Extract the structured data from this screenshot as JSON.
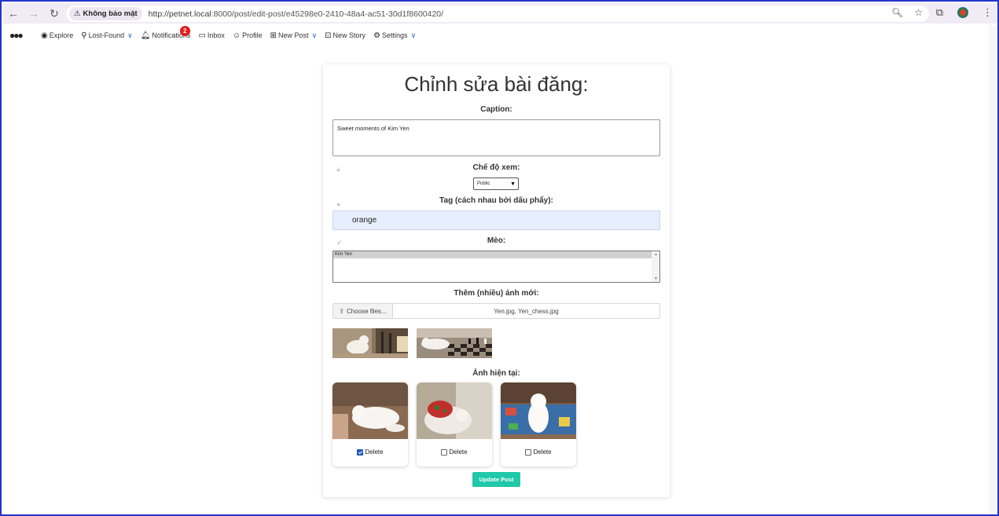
{
  "browser": {
    "security_label": "Không bảo mật",
    "url_host": "http://petnet.local",
    "url_rest": ":8000/post/edit-post/e45298e0-2410-48a4-ac51-30d1f8600420/"
  },
  "nav": {
    "explore": "Explore",
    "lost_found": "Lost-Found",
    "notifications": "Notifications",
    "notifications_count": "2",
    "inbox": "Inbox",
    "profile": "Profile",
    "new_post": "New Post",
    "new_story": "New Story",
    "settings": "Settings"
  },
  "form": {
    "title": "Chỉnh sửa bài đăng:",
    "caption_label": "Caption:",
    "caption_value": "Sweet moments of Kim Yen",
    "visibility_label": "Chế độ xem:",
    "visibility_value": "Public",
    "tag_label": "Tag (cách nhau bởi dấu phẩy):",
    "tag_value": "orange",
    "cat_label": "Mèo:",
    "cat_options": [
      "Kim Yen"
    ],
    "new_images_label": "Thêm (nhiều) ảnh mới:",
    "choose_files": "Choose files...",
    "chosen_files": "Yen.jpg, Yen_chess.jpg",
    "current_images_label": "Ảnh hiện tại:",
    "delete_label": "Delete",
    "current_images": [
      {
        "delete_checked": true
      },
      {
        "delete_checked": false
      },
      {
        "delete_checked": false
      }
    ],
    "submit": "Update Post"
  }
}
